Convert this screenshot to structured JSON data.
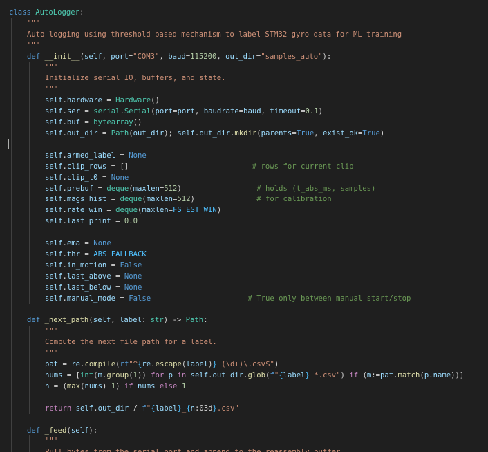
{
  "editor": {
    "language": "python",
    "class_name": "AutoLogger",
    "lines": [
      [
        [
          "kw",
          "class"
        ],
        [
          "txt",
          " "
        ],
        [
          "cls",
          "AutoLogger"
        ],
        [
          "txt",
          ":"
        ]
      ],
      [
        [
          "doc",
          "\"\"\""
        ]
      ],
      [
        [
          "doc",
          "Auto logging using threshold based mechanism to label STM32 gyro data for ML training"
        ]
      ],
      [
        [
          "doc",
          "\"\"\""
        ]
      ],
      [
        [
          "kw",
          "def"
        ],
        [
          "txt",
          " "
        ],
        [
          "fn",
          "__init__"
        ],
        [
          "txt",
          "("
        ],
        [
          "var",
          "self"
        ],
        [
          "txt",
          ", "
        ],
        [
          "var",
          "port"
        ],
        [
          "txt",
          "="
        ],
        [
          "str",
          "\"COM3\""
        ],
        [
          "txt",
          ", "
        ],
        [
          "var",
          "baud"
        ],
        [
          "txt",
          "="
        ],
        [
          "num",
          "115200"
        ],
        [
          "txt",
          ", "
        ],
        [
          "var",
          "out_dir"
        ],
        [
          "txt",
          "="
        ],
        [
          "str",
          "\"samples_auto\""
        ],
        [
          "txt",
          "):"
        ]
      ],
      [
        [
          "doc",
          "\"\"\""
        ]
      ],
      [
        [
          "doc",
          "Initialize serial IO, buffers, and state."
        ]
      ],
      [
        [
          "doc",
          "\"\"\""
        ]
      ],
      [
        [
          "var",
          "self"
        ],
        [
          "txt",
          "."
        ],
        [
          "var",
          "hardware"
        ],
        [
          "txt",
          " = "
        ],
        [
          "cls",
          "Hardware"
        ],
        [
          "txt",
          "()"
        ]
      ],
      [
        [
          "var",
          "self"
        ],
        [
          "txt",
          "."
        ],
        [
          "var",
          "ser"
        ],
        [
          "txt",
          " = "
        ],
        [
          "cls",
          "serial"
        ],
        [
          "txt",
          "."
        ],
        [
          "cls",
          "Serial"
        ],
        [
          "txt",
          "("
        ],
        [
          "var",
          "port"
        ],
        [
          "txt",
          "="
        ],
        [
          "var",
          "port"
        ],
        [
          "txt",
          ", "
        ],
        [
          "var",
          "baudrate"
        ],
        [
          "txt",
          "="
        ],
        [
          "var",
          "baud"
        ],
        [
          "txt",
          ", "
        ],
        [
          "var",
          "timeout"
        ],
        [
          "txt",
          "="
        ],
        [
          "num",
          "0.1"
        ],
        [
          "txt",
          ")"
        ]
      ],
      [
        [
          "var",
          "self"
        ],
        [
          "txt",
          "."
        ],
        [
          "var",
          "buf"
        ],
        [
          "txt",
          " = "
        ],
        [
          "cls",
          "bytearray"
        ],
        [
          "txt",
          "()"
        ]
      ],
      [
        [
          "var",
          "self"
        ],
        [
          "txt",
          "."
        ],
        [
          "var",
          "out_dir"
        ],
        [
          "txt",
          " = "
        ],
        [
          "cls",
          "Path"
        ],
        [
          "txt",
          "("
        ],
        [
          "var",
          "out_dir"
        ],
        [
          "txt",
          "); "
        ],
        [
          "var",
          "self"
        ],
        [
          "txt",
          "."
        ],
        [
          "var",
          "out_dir"
        ],
        [
          "txt",
          "."
        ],
        [
          "fn",
          "mkdir"
        ],
        [
          "txt",
          "("
        ],
        [
          "var",
          "parents"
        ],
        [
          "txt",
          "="
        ],
        [
          "kw",
          "True"
        ],
        [
          "txt",
          ", "
        ],
        [
          "var",
          "exist_ok"
        ],
        [
          "txt",
          "="
        ],
        [
          "kw",
          "True"
        ],
        [
          "txt",
          ")"
        ]
      ],
      [],
      [
        [
          "var",
          "self"
        ],
        [
          "txt",
          "."
        ],
        [
          "var",
          "armed_label"
        ],
        [
          "txt",
          " = "
        ],
        [
          "kw",
          "None"
        ]
      ],
      [
        [
          "var",
          "self"
        ],
        [
          "txt",
          "."
        ],
        [
          "var",
          "clip_rows"
        ],
        [
          "txt",
          " = []                            "
        ],
        [
          "cmt",
          "# rows for current clip"
        ]
      ],
      [
        [
          "var",
          "self"
        ],
        [
          "txt",
          "."
        ],
        [
          "var",
          "clip_t0"
        ],
        [
          "txt",
          " = "
        ],
        [
          "kw",
          "None"
        ]
      ],
      [
        [
          "var",
          "self"
        ],
        [
          "txt",
          "."
        ],
        [
          "var",
          "prebuf"
        ],
        [
          "txt",
          " = "
        ],
        [
          "cls",
          "deque"
        ],
        [
          "txt",
          "("
        ],
        [
          "var",
          "maxlen"
        ],
        [
          "txt",
          "="
        ],
        [
          "num",
          "512"
        ],
        [
          "txt",
          ")                 "
        ],
        [
          "cmt",
          "# holds (t_abs_ms, samples)"
        ]
      ],
      [
        [
          "var",
          "self"
        ],
        [
          "txt",
          "."
        ],
        [
          "var",
          "mags_hist"
        ],
        [
          "txt",
          " = "
        ],
        [
          "cls",
          "deque"
        ],
        [
          "txt",
          "("
        ],
        [
          "var",
          "maxlen"
        ],
        [
          "txt",
          "="
        ],
        [
          "num",
          "512"
        ],
        [
          "txt",
          ")              "
        ],
        [
          "cmt",
          "# for calibration"
        ]
      ],
      [
        [
          "var",
          "self"
        ],
        [
          "txt",
          "."
        ],
        [
          "var",
          "rate_win"
        ],
        [
          "txt",
          " = "
        ],
        [
          "cls",
          "deque"
        ],
        [
          "txt",
          "("
        ],
        [
          "var",
          "maxlen"
        ],
        [
          "txt",
          "="
        ],
        [
          "const",
          "FS_EST_WIN"
        ],
        [
          "txt",
          ")"
        ]
      ],
      [
        [
          "var",
          "self"
        ],
        [
          "txt",
          "."
        ],
        [
          "var",
          "last_print"
        ],
        [
          "txt",
          " = "
        ],
        [
          "num",
          "0.0"
        ]
      ],
      [],
      [
        [
          "var",
          "self"
        ],
        [
          "txt",
          "."
        ],
        [
          "var",
          "ema"
        ],
        [
          "txt",
          " = "
        ],
        [
          "kw",
          "None"
        ]
      ],
      [
        [
          "var",
          "self"
        ],
        [
          "txt",
          "."
        ],
        [
          "var",
          "thr"
        ],
        [
          "txt",
          " = "
        ],
        [
          "const",
          "ABS_FALLBACK"
        ]
      ],
      [
        [
          "var",
          "self"
        ],
        [
          "txt",
          "."
        ],
        [
          "var",
          "in_motion"
        ],
        [
          "txt",
          " = "
        ],
        [
          "kw",
          "False"
        ]
      ],
      [
        [
          "var",
          "self"
        ],
        [
          "txt",
          "."
        ],
        [
          "var",
          "last_above"
        ],
        [
          "txt",
          " = "
        ],
        [
          "kw",
          "None"
        ]
      ],
      [
        [
          "var",
          "self"
        ],
        [
          "txt",
          "."
        ],
        [
          "var",
          "last_below"
        ],
        [
          "txt",
          " = "
        ],
        [
          "kw",
          "None"
        ]
      ],
      [
        [
          "var",
          "self"
        ],
        [
          "txt",
          "."
        ],
        [
          "var",
          "manual_mode"
        ],
        [
          "txt",
          " = "
        ],
        [
          "kw",
          "False"
        ],
        [
          "txt",
          "                      "
        ],
        [
          "cmt",
          "# True only between manual start/stop"
        ]
      ],
      [],
      [
        [
          "kw",
          "def"
        ],
        [
          "txt",
          " "
        ],
        [
          "fn",
          "_next_path"
        ],
        [
          "txt",
          "("
        ],
        [
          "var",
          "self"
        ],
        [
          "txt",
          ", "
        ],
        [
          "var",
          "label"
        ],
        [
          "txt",
          ": "
        ],
        [
          "cls",
          "str"
        ],
        [
          "txt",
          ") -> "
        ],
        [
          "cls",
          "Path"
        ],
        [
          "txt",
          ":"
        ]
      ],
      [
        [
          "doc",
          "\"\"\""
        ]
      ],
      [
        [
          "doc",
          "Compute the next file path for a label."
        ]
      ],
      [
        [
          "doc",
          "\"\"\""
        ]
      ],
      [
        [
          "var",
          "pat"
        ],
        [
          "txt",
          " = "
        ],
        [
          "var",
          "re"
        ],
        [
          "txt",
          "."
        ],
        [
          "fn",
          "compile"
        ],
        [
          "txt",
          "("
        ],
        [
          "kw",
          "rf"
        ],
        [
          "str",
          "\"^"
        ],
        [
          "const",
          "{"
        ],
        [
          "var",
          "re"
        ],
        [
          "txt",
          "."
        ],
        [
          "fn",
          "escape"
        ],
        [
          "txt",
          "("
        ],
        [
          "var",
          "label"
        ],
        [
          "txt",
          ")"
        ],
        [
          "const",
          "}"
        ],
        [
          "str",
          "_(\\d+)\\.csv$\""
        ],
        [
          "txt",
          ")"
        ]
      ],
      [
        [
          "var",
          "nums"
        ],
        [
          "txt",
          " = ["
        ],
        [
          "cls",
          "int"
        ],
        [
          "txt",
          "("
        ],
        [
          "var",
          "m"
        ],
        [
          "txt",
          "."
        ],
        [
          "fn",
          "group"
        ],
        [
          "txt",
          "("
        ],
        [
          "num",
          "1"
        ],
        [
          "txt",
          "))"
        ],
        [
          "ctl",
          " for "
        ],
        [
          "var",
          "p"
        ],
        [
          "ctl",
          " in "
        ],
        [
          "var",
          "self"
        ],
        [
          "txt",
          "."
        ],
        [
          "var",
          "out_dir"
        ],
        [
          "txt",
          "."
        ],
        [
          "fn",
          "glob"
        ],
        [
          "txt",
          "("
        ],
        [
          "kw",
          "f"
        ],
        [
          "str",
          "\""
        ],
        [
          "const",
          "{"
        ],
        [
          "var",
          "label"
        ],
        [
          "const",
          "}"
        ],
        [
          "str",
          "_*.csv\""
        ],
        [
          "txt",
          ")"
        ],
        [
          "ctl",
          " if "
        ],
        [
          "txt",
          "("
        ],
        [
          "var",
          "m"
        ],
        [
          "txt",
          ":="
        ],
        [
          "var",
          "pat"
        ],
        [
          "txt",
          "."
        ],
        [
          "fn",
          "match"
        ],
        [
          "txt",
          "("
        ],
        [
          "var",
          "p"
        ],
        [
          "txt",
          "."
        ],
        [
          "var",
          "name"
        ],
        [
          "txt",
          "))]"
        ]
      ],
      [
        [
          "var",
          "n"
        ],
        [
          "txt",
          " = ("
        ],
        [
          "fn",
          "max"
        ],
        [
          "txt",
          "("
        ],
        [
          "var",
          "nums"
        ],
        [
          "txt",
          ")+"
        ],
        [
          "num",
          "1"
        ],
        [
          "txt",
          ")"
        ],
        [
          "ctl",
          " if "
        ],
        [
          "var",
          "nums"
        ],
        [
          "ctl",
          " else "
        ],
        [
          "num",
          "1"
        ]
      ],
      [],
      [
        [
          "ctl",
          "return"
        ],
        [
          "txt",
          " "
        ],
        [
          "var",
          "self"
        ],
        [
          "txt",
          "."
        ],
        [
          "var",
          "out_dir"
        ],
        [
          "txt",
          " / "
        ],
        [
          "kw",
          "f"
        ],
        [
          "str",
          "\""
        ],
        [
          "const",
          "{"
        ],
        [
          "var",
          "label"
        ],
        [
          "const",
          "}"
        ],
        [
          "str",
          "_"
        ],
        [
          "const",
          "{"
        ],
        [
          "var",
          "n"
        ],
        [
          "txt",
          ":03d"
        ],
        [
          "const",
          "}"
        ],
        [
          "str",
          ".csv\""
        ]
      ],
      [],
      [
        [
          "kw",
          "def"
        ],
        [
          "txt",
          " "
        ],
        [
          "fn",
          "_feed"
        ],
        [
          "txt",
          "("
        ],
        [
          "var",
          "self"
        ],
        [
          "txt",
          "):"
        ]
      ],
      [
        [
          "doc",
          "\"\"\""
        ]
      ],
      [
        [
          "doc",
          "Pull bytes from the serial port and append to the reassembly buffer."
        ]
      ]
    ]
  }
}
